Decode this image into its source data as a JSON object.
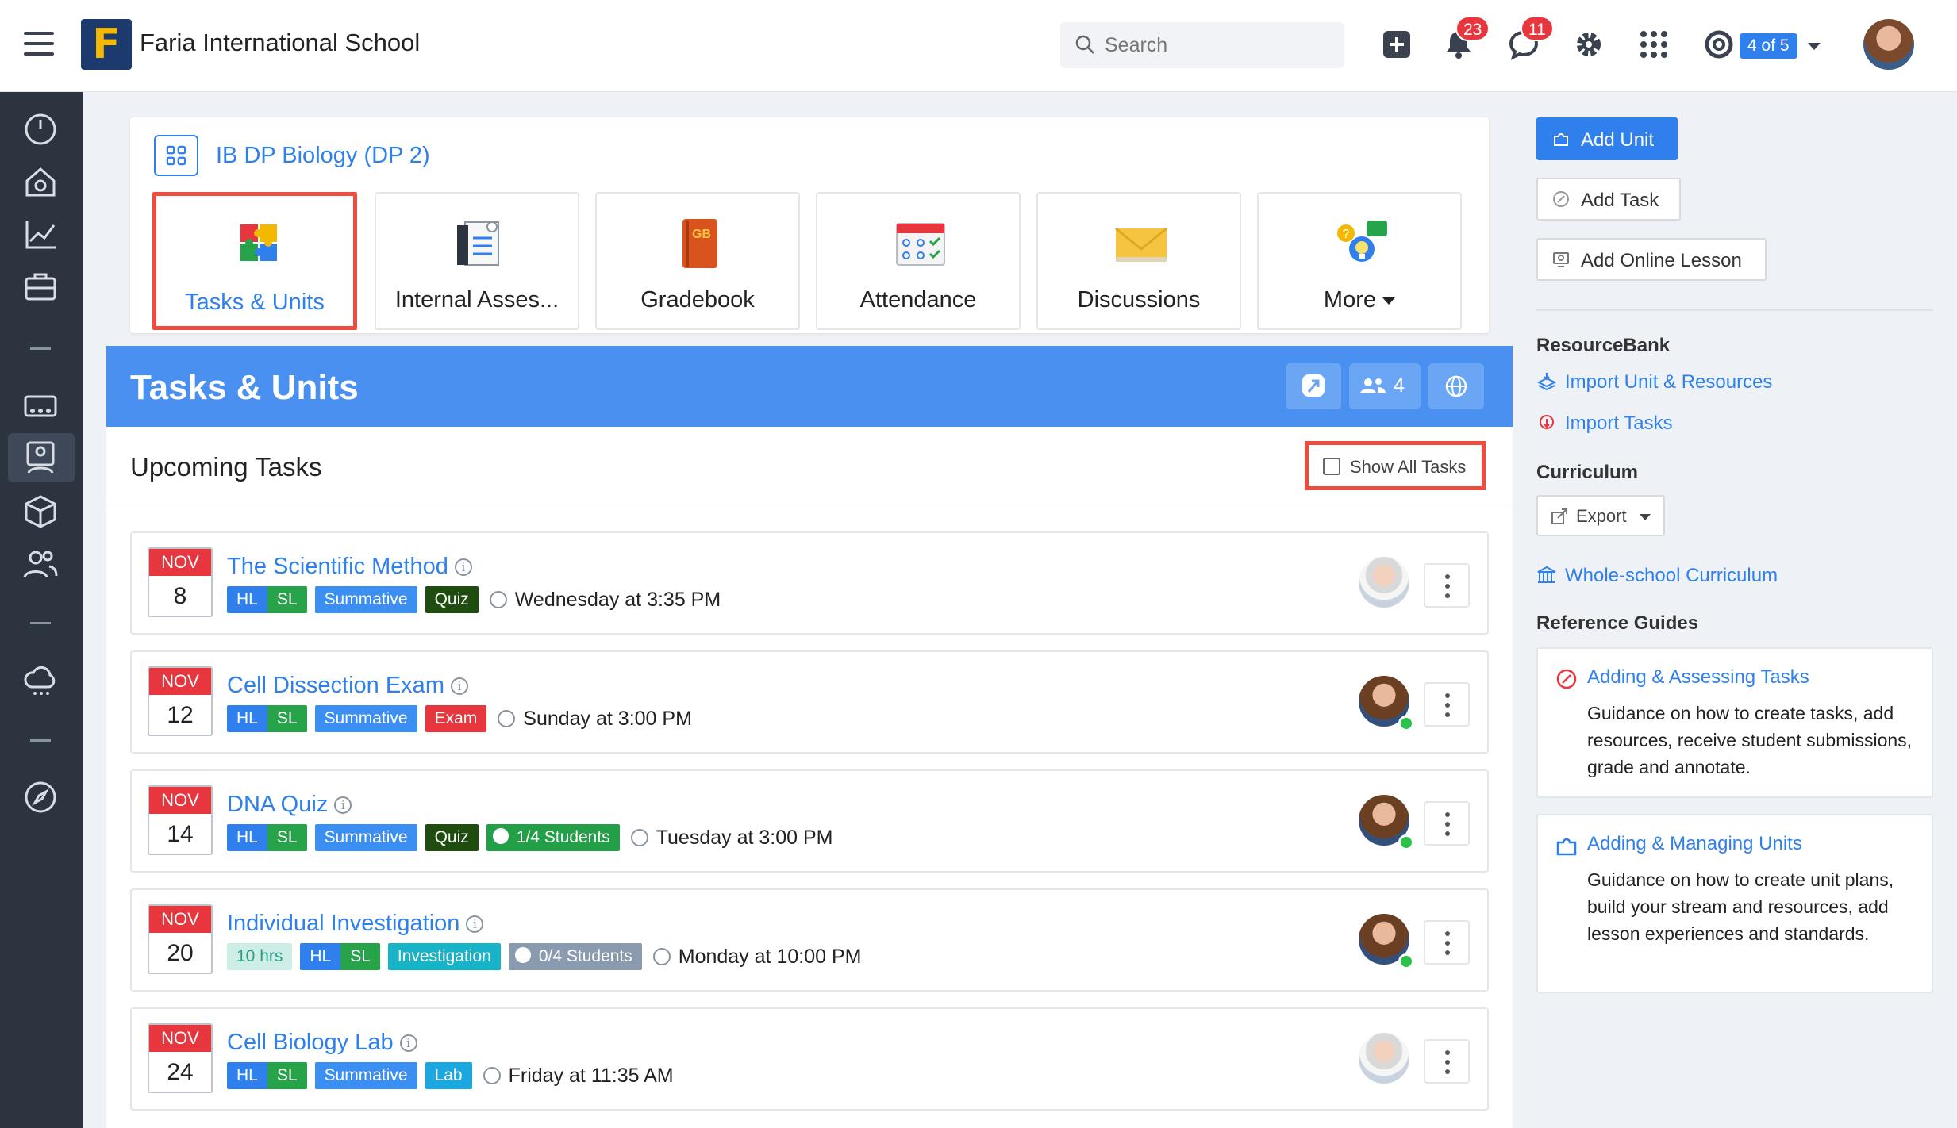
{
  "header": {
    "school_name": "Faria International School",
    "logo_letter": "F",
    "search_placeholder": "Search",
    "notifications_count": "23",
    "messages_count": "11",
    "pager_label": "4 of 5"
  },
  "course": {
    "title": "IB DP Biology (DP 2)",
    "tiles": [
      {
        "label": "Tasks & Units",
        "icon": "puzzle-icon"
      },
      {
        "label": "Internal Asses...",
        "icon": "assessment-icon"
      },
      {
        "label": "Gradebook",
        "icon": "gradebook-icon"
      },
      {
        "label": "Attendance",
        "icon": "attendance-icon"
      },
      {
        "label": "Discussions",
        "icon": "envelope-icon"
      },
      {
        "label": "More",
        "icon": "more-help-icon"
      }
    ],
    "gradebook_badge": "GB"
  },
  "tasks_panel": {
    "title": "Tasks & Units",
    "members_count": "4",
    "upcoming_heading": "Upcoming Tasks",
    "show_all_label": "Show All Tasks",
    "tasks": [
      {
        "month": "NOV",
        "day": "8",
        "title": "The Scientific Method",
        "tags": [
          "HL",
          "SL",
          "Summative",
          "Quiz"
        ],
        "when": "Wednesday at 3:35 PM"
      },
      {
        "month": "NOV",
        "day": "12",
        "title": "Cell Dissection Exam",
        "tags": [
          "HL",
          "SL",
          "Summative",
          "Exam"
        ],
        "when": "Sunday at 3:00 PM"
      },
      {
        "month": "NOV",
        "day": "14",
        "title": "DNA Quiz",
        "tags": [
          "HL",
          "SL",
          "Summative",
          "Quiz"
        ],
        "students": "1/4 Students",
        "when": "Tuesday at 3:00 PM"
      },
      {
        "month": "NOV",
        "day": "20",
        "title": "Individual Investigation",
        "hours": "10 hrs",
        "tags": [
          "HL",
          "SL",
          "Investigation"
        ],
        "students": "0/4 Students",
        "when": "Monday at 10:00 PM"
      },
      {
        "month": "NOV",
        "day": "24",
        "title": "Cell Biology Lab",
        "tags": [
          "HL",
          "SL",
          "Summative",
          "Lab"
        ],
        "when": "Friday at 11:35 AM"
      }
    ]
  },
  "sidebar": {
    "add_unit": "Add Unit",
    "add_task": "Add Task",
    "add_online_lesson": "Add Online Lesson",
    "resourcebank_heading": "ResourceBank",
    "import_unit": "Import Unit & Resources",
    "import_tasks": "Import Tasks",
    "curriculum_heading": "Curriculum",
    "export_label": "Export",
    "whole_school": "Whole-school Curriculum",
    "reference_heading": "Reference Guides",
    "guides": [
      {
        "title": "Adding & Assessing Tasks",
        "desc": "Guidance on how to create tasks, add resources, receive student submissions, grade and annotate."
      },
      {
        "title": "Adding & Managing Units",
        "desc": "Guidance on how to create unit plans, build your stream and resources, add lesson experiences and standards."
      }
    ]
  },
  "colors": {
    "brand_blue": "#2f80ed",
    "highlight_red": "#ef4c3f",
    "rail_dark": "#2c3440"
  }
}
